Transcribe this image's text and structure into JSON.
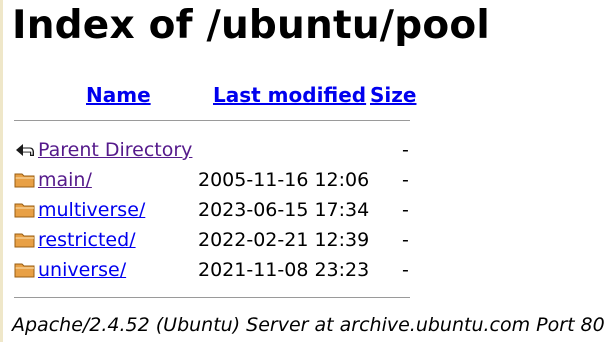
{
  "heading": "Index of /ubuntu/pool",
  "columns": {
    "name": "Name",
    "last_modified": "Last modified",
    "size": "Size"
  },
  "rows": [
    {
      "name": "Parent Directory",
      "date": "",
      "size": "-",
      "icon": "back-icon",
      "visited": true
    },
    {
      "name": "main/",
      "date": "2005-11-16 12:06",
      "size": "-",
      "icon": "folder-icon",
      "visited": true
    },
    {
      "name": "multiverse/",
      "date": "2023-06-15 17:34",
      "size": "-",
      "icon": "folder-icon",
      "visited": false
    },
    {
      "name": "restricted/",
      "date": "2022-02-21 12:39",
      "size": "-",
      "icon": "folder-icon",
      "visited": false
    },
    {
      "name": "universe/",
      "date": "2021-11-08 23:23",
      "size": "-",
      "icon": "folder-icon",
      "visited": false
    }
  ],
  "footer": "Apache/2.4.52 (Ubuntu) Server at archive.ubuntu.com Port 80",
  "colors": {
    "link": "#0000ee",
    "visited_link": "#551a8b",
    "folder": "#e8a045",
    "rule": "#9a9a9a"
  }
}
